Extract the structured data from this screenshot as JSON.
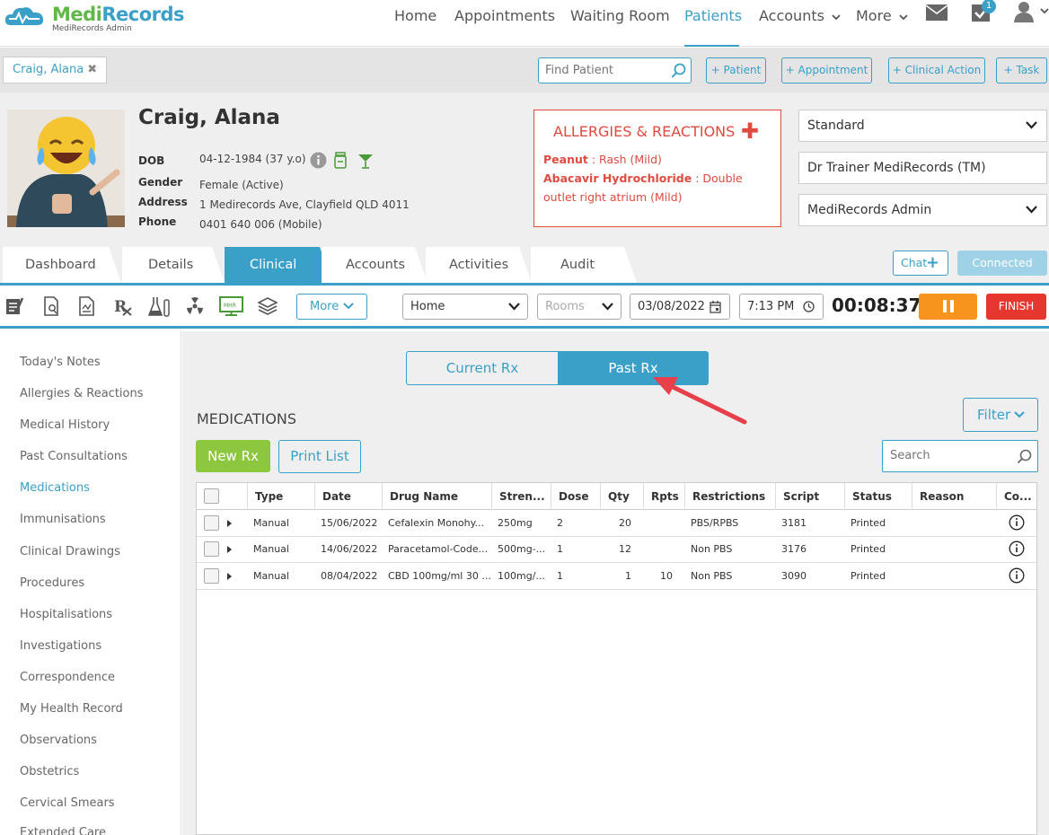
{
  "app": {
    "logo_name_medi": "Medi",
    "logo_name_records": "Records",
    "logo_sub": "MediRecords Admin"
  },
  "nav": {
    "items": [
      {
        "label": "Home"
      },
      {
        "label": "Appointments"
      },
      {
        "label": "Waiting Room"
      },
      {
        "label": "Patients"
      },
      {
        "label": "Accounts"
      },
      {
        "label": "More"
      }
    ],
    "active": "Patients",
    "tasks_badge": "1"
  },
  "patient_bar": {
    "tab_label": "Craig, Alana",
    "find_placeholder": "Find Patient",
    "buttons": [
      "+ Patient",
      "+ Appointment",
      "+ Clinical Action",
      "+ Task"
    ]
  },
  "patient": {
    "name": "Craig, Alana",
    "labels": {
      "dob": "DOB",
      "gender": "Gender",
      "address": "Address",
      "phone": "Phone"
    },
    "dob": "04-12-1984 (37 y.o)",
    "gender": "Female (Active)",
    "address": "1 Medirecords Ave, Clayfield QLD 4011",
    "phone": "0401 640 006 (Mobile)"
  },
  "allergies": {
    "title": "ALLERGIES & REACTIONS",
    "items": [
      {
        "name": "Peanut",
        "sep": " : ",
        "reaction": "Rash (Mild)"
      },
      {
        "name": "Abacavir Hydrochloride",
        "sep": " : ",
        "reaction": "Double outlet right atrium (Mild)"
      }
    ]
  },
  "selects": {
    "billing": "Standard",
    "practitioner": "Dr Trainer MediRecords (TM)",
    "admin": "MediRecords Admin"
  },
  "tabs": [
    "Dashboard",
    "Details",
    "Clinical",
    "Accounts",
    "Activities",
    "Audit"
  ],
  "active_tab": "Clinical",
  "chat_label": "Chat",
  "connected_label": "Connected",
  "toolbar": {
    "more_label": "More",
    "location": "Home",
    "rooms_placeholder": "Rooms",
    "date": "03/08/2022",
    "time": "7:13 PM",
    "timer": "00:08:37",
    "finish_label": "FINISH"
  },
  "sidebar": {
    "items": [
      "Today's Notes",
      "Allergies & Reactions",
      "Medical History",
      "Past Consultations",
      "Medications",
      "Immunisations",
      "Clinical Drawings",
      "Procedures",
      "Hospitalisations",
      "Investigations",
      "Correspondence",
      "My Health Record",
      "Observations",
      "Obstetrics",
      "Cervical Smears",
      "Extended Care"
    ],
    "active": "Medications"
  },
  "main": {
    "seg_current": "Current Rx",
    "seg_past": "Past Rx",
    "title": "MEDICATIONS",
    "filter_label": "Filter",
    "new_rx_label": "New Rx",
    "print_list_label": "Print List",
    "search_placeholder": "Search"
  },
  "table": {
    "columns": [
      "Type",
      "Date",
      "Drug Name",
      "Stren...",
      "Dose",
      "Qty",
      "Rpts",
      "Restrictions",
      "Script",
      "Status",
      "Reason",
      "Co..."
    ],
    "rows": [
      {
        "type": "Manual",
        "date": "15/06/2022",
        "drug": "Cefalexin Monohy...",
        "strength": "250mg",
        "dose": "2",
        "qty": "20",
        "rpts": "",
        "restrictions": "PBS/RPBS",
        "script": "3181",
        "status": "Printed",
        "reason": ""
      },
      {
        "type": "Manual",
        "date": "14/06/2022",
        "drug": "Paracetamol-Code...",
        "strength": "500mg-...",
        "dose": "1",
        "qty": "12",
        "rpts": "",
        "restrictions": "Non PBS",
        "script": "3176",
        "status": "Printed",
        "reason": ""
      },
      {
        "type": "Manual",
        "date": "08/04/2022",
        "drug": "CBD 100mg/ml 30 ...",
        "strength": "100mg/...",
        "dose": "1",
        "qty": "1",
        "rpts": "10",
        "restrictions": "Non PBS",
        "script": "3090",
        "status": "Printed",
        "reason": ""
      }
    ]
  },
  "colors": {
    "brand_blue": "#3aa0c8",
    "brand_green": "#8dc63f",
    "alert_red": "#e04a3f",
    "pause_orange": "#f7941d",
    "finish_red": "#e5372e"
  }
}
